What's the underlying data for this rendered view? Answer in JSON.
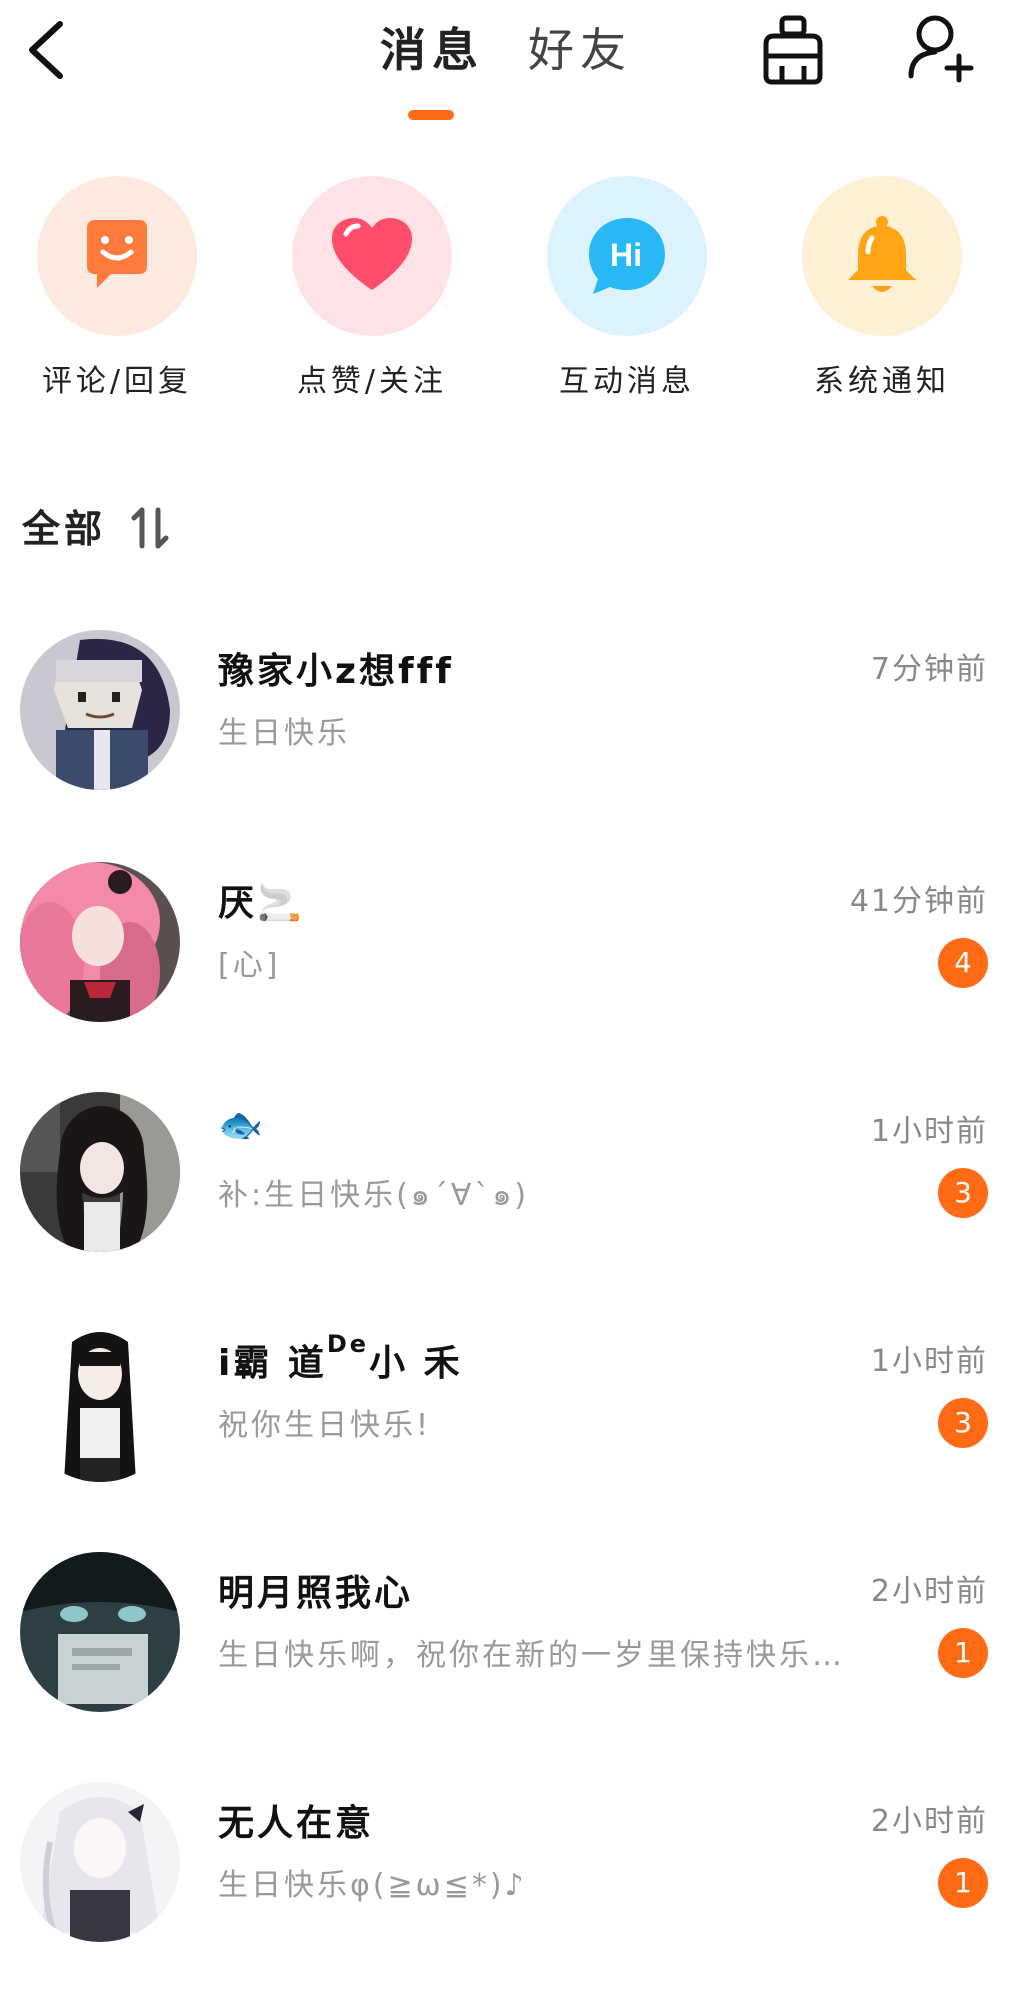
{
  "header": {
    "tabs": [
      {
        "label": "消息",
        "active": true
      },
      {
        "label": "好友",
        "active": false
      }
    ],
    "back_icon": "chevron-left-icon",
    "clean_icon": "broom-icon",
    "add_friend_icon": "add-person-icon",
    "accent_color": "#ff6a14"
  },
  "categories": [
    {
      "label": "评论/回复",
      "icon": "comment-smile-icon",
      "bg": "#fde9df",
      "color": "#ff7a3d"
    },
    {
      "label": "点赞/关注",
      "icon": "heart-icon",
      "bg": "#fde3e6",
      "color": "#ff4d6b"
    },
    {
      "label": "互动消息",
      "icon": "hi-bubble-icon",
      "bg": "#dcf2fd",
      "color": "#29b8f6"
    },
    {
      "label": "系统通知",
      "icon": "bell-icon",
      "bg": "#fdf0d5",
      "color": "#ffa414"
    }
  ],
  "section": {
    "title": "全部",
    "sort_icon": "sort-icon"
  },
  "messages": [
    {
      "name": "豫家小z想fff",
      "time": "7分钟前",
      "preview": "生日快乐",
      "badge": ""
    },
    {
      "name": "厌🚬",
      "time": "41分钟前",
      "preview": "[心]",
      "badge": "4"
    },
    {
      "name": "🐟",
      "time": "1小时前",
      "preview": "补:生日快乐(๑´∀`๑)",
      "badge": "3"
    },
    {
      "name_prefix": "i霸 道",
      "name_sup": "De",
      "name_suffix": "小 禾",
      "time": "1小时前",
      "preview": "祝你生日快乐!",
      "badge": "3"
    },
    {
      "name": "明月照我心",
      "time": "2小时前",
      "preview": "生日快乐啊，祝你在新的一岁里保持快乐…",
      "badge": "1"
    },
    {
      "name": "无人在意",
      "time": "2小时前",
      "preview": "生日快乐φ(≧ω≦*)♪",
      "badge": "1"
    }
  ]
}
